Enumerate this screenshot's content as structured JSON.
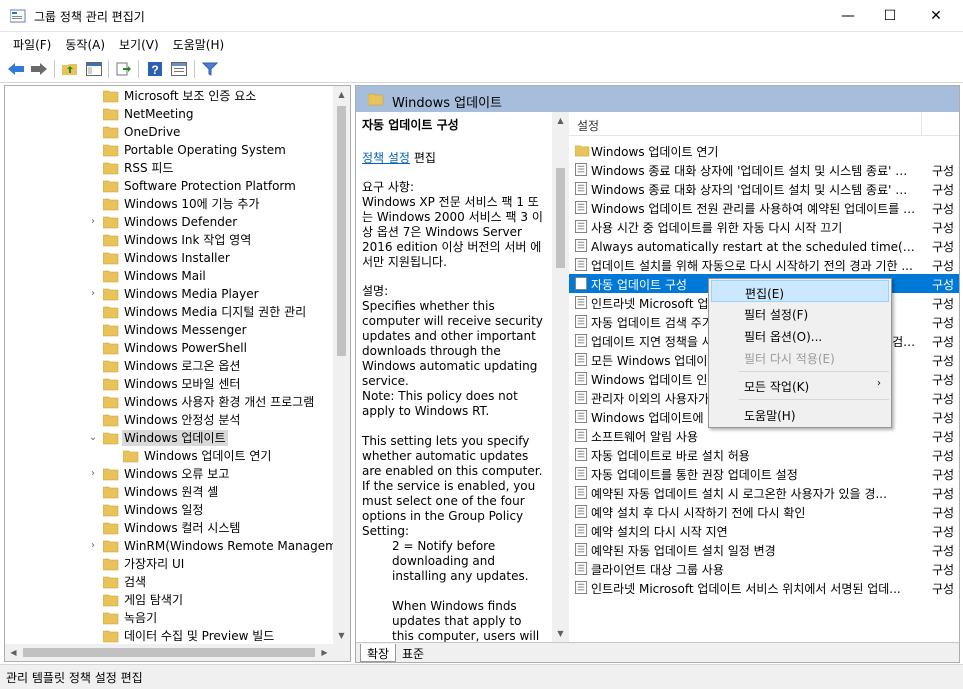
{
  "window": {
    "title": "그룹 정책 관리 편집기",
    "minimize": "—",
    "maximize": "☐",
    "close": "✕"
  },
  "menu": [
    "파일(F)",
    "동작(A)",
    "보기(V)",
    "도움말(H)"
  ],
  "tree": {
    "items": [
      {
        "label": "Microsoft 보조 인증 요소",
        "expandable": false,
        "level": 1
      },
      {
        "label": "NetMeeting",
        "expandable": false,
        "level": 1
      },
      {
        "label": "OneDrive",
        "expandable": false,
        "level": 1
      },
      {
        "label": "Portable Operating System",
        "expandable": false,
        "level": 1
      },
      {
        "label": "RSS 피드",
        "expandable": false,
        "level": 1
      },
      {
        "label": "Software Protection Platform",
        "expandable": false,
        "level": 1
      },
      {
        "label": "Windows 10에 기능 추가",
        "expandable": false,
        "level": 1
      },
      {
        "label": "Windows Defender",
        "expandable": true,
        "level": 1
      },
      {
        "label": "Windows Ink 작업 영역",
        "expandable": false,
        "level": 1
      },
      {
        "label": "Windows Installer",
        "expandable": false,
        "level": 1
      },
      {
        "label": "Windows Mail",
        "expandable": false,
        "level": 1
      },
      {
        "label": "Windows Media Player",
        "expandable": true,
        "level": 1
      },
      {
        "label": "Windows Media 디지털 권한 관리",
        "expandable": false,
        "level": 1
      },
      {
        "label": "Windows Messenger",
        "expandable": false,
        "level": 1
      },
      {
        "label": "Windows PowerShell",
        "expandable": false,
        "level": 1
      },
      {
        "label": "Windows 로그온 옵션",
        "expandable": false,
        "level": 1
      },
      {
        "label": "Windows 모바일 센터",
        "expandable": false,
        "level": 1
      },
      {
        "label": "Windows 사용자 환경 개선 프로그램",
        "expandable": false,
        "level": 1
      },
      {
        "label": "Windows 안정성 분석",
        "expandable": false,
        "level": 1
      },
      {
        "label": "Windows 업데이트",
        "expandable": true,
        "expanded": true,
        "selected": true,
        "level": 1
      },
      {
        "label": "Windows 업데이트 연기",
        "expandable": false,
        "level": 2
      },
      {
        "label": "Windows 오류 보고",
        "expandable": true,
        "level": 1
      },
      {
        "label": "Windows 원격 셸",
        "expandable": false,
        "level": 1
      },
      {
        "label": "Windows 일정",
        "expandable": false,
        "level": 1
      },
      {
        "label": "Windows 컬러 시스템",
        "expandable": false,
        "level": 1
      },
      {
        "label": "WinRM(Windows Remote Managemen",
        "expandable": true,
        "level": 1
      },
      {
        "label": "가장자리 UI",
        "expandable": false,
        "level": 1
      },
      {
        "label": "검색",
        "expandable": false,
        "level": 1
      },
      {
        "label": "게임 탐색기",
        "expandable": false,
        "level": 1
      },
      {
        "label": "녹음기",
        "expandable": false,
        "level": 1
      },
      {
        "label": "데이터 수집 및 Preview 빌드",
        "expandable": false,
        "level": 1
      }
    ]
  },
  "right": {
    "header_title": "Windows 업데이트",
    "desc": {
      "title": "자동 업데이트 구성",
      "policy_link": "정책 설정",
      "policy_edit": "편집",
      "req_label": "요구 사항:",
      "req_text": "Windows XP 전문 서비스 팩 1 또는 Windows 2000 서비스 팩 3 이상 옵션 7은 Windows Server 2016 edition 이상 버전의 서버 에서만 지원됩니다.",
      "desc_label": "설명:",
      "desc_p1": "Specifies whether this computer will receive security updates and other important downloads through the Windows automatic updating service.",
      "desc_p2": "Note: This policy does not apply to Windows RT.",
      "desc_p3": "This setting lets you specify whether automatic updates are enabled on this computer. If the service is enabled, you must select one of the four options in the Group Policy Setting:",
      "desc_p4": "2 = Notify before downloading and installing any updates.",
      "desc_p5": "When Windows finds updates that apply to this computer, users will be notified"
    },
    "list": {
      "col_setting": "설정",
      "items": [
        {
          "name": "Windows 업데이트 연기",
          "state": "",
          "folder": true
        },
        {
          "name": "Windows 종료 대화 상자에 '업데이트 설치 및 시스템 종료' 옵...",
          "state": "구성"
        },
        {
          "name": "Windows 종료 대화 상자의 '업데이트 설치 및 시스템 종료' 옵...",
          "state": "구성"
        },
        {
          "name": "Windows 업데이트 전원 관리를 사용하여 예약된 업데이트를 설...",
          "state": "구성"
        },
        {
          "name": "사용 시간 중 업데이트를 위한 자동 다시 시작 끄기",
          "state": "구성"
        },
        {
          "name": "Always automatically restart at the scheduled time(항상 예...",
          "state": "구성"
        },
        {
          "name": "업데이트 설치를 위해 자동으로 다시 시작하기 전의 경과 기한 ...",
          "state": "구성"
        },
        {
          "name": "자동 업데이트 구성",
          "state": "구성",
          "selected": true
        },
        {
          "name": "인트라넷 Microsoft 업데이트 서비스 위치 지정",
          "state": "구성"
        },
        {
          "name": "자동 업데이트 검색 주기",
          "state": "구성"
        },
        {
          "name": "업데이트 지연 정책을 사용하여 Windows 업데이트에 대한 검사...",
          "state": "구성"
        },
        {
          "name": "모든 Windows 업데이트 기능에 대한 액세스 권한 제거",
          "state": "구성"
        },
        {
          "name": "Windows 업데이트 인터넷 위치에 연결하지 않음",
          "state": "구성"
        },
        {
          "name": "관리자 이외의 사용자가 업데이트 알림을 받도록 허용",
          "state": "구성"
        },
        {
          "name": "Windows 업데이트에 드라이버 포함 안 함",
          "state": "구성"
        },
        {
          "name": "소프트웨어 알림 사용",
          "state": "구성"
        },
        {
          "name": "자동 업데이트로 바로 설치 허용",
          "state": "구성"
        },
        {
          "name": "자동 업데이트를 통한 권장 업데이트 설정",
          "state": "구성"
        },
        {
          "name": "예약된 자동 업데이트 설치 시 로그온한 사용자가 있을 경...",
          "state": "구성"
        },
        {
          "name": "예약 설치 후 다시 시작하기 전에 다시 확인",
          "state": "구성"
        },
        {
          "name": "예약 설치의 다시 시작 지연",
          "state": "구성"
        },
        {
          "name": "예약된 자동 업데이트 설치 일정 변경",
          "state": "구성"
        },
        {
          "name": "클라이언트 대상 그룹 사용",
          "state": "구성"
        },
        {
          "name": "인트라넷 Microsoft 업데이트 서비스 위치에서 서명된 업데...",
          "state": "구성"
        }
      ]
    },
    "tabs": [
      "확장",
      "표준"
    ]
  },
  "context_menu": {
    "edit": "편집(E)",
    "filter_settings": "필터 설정(F)",
    "filter_options": "필터 옵션(O)...",
    "reapply_filter": "필터 다시 적용(E)",
    "all_tasks": "모든 작업(K)",
    "help": "도움말(H)"
  },
  "status": "관리 템플릿 정책 설정 편집",
  "colors": {
    "selection": "#0078d7",
    "pane_header": "#a6bddc",
    "folder": "#e8c25b"
  }
}
